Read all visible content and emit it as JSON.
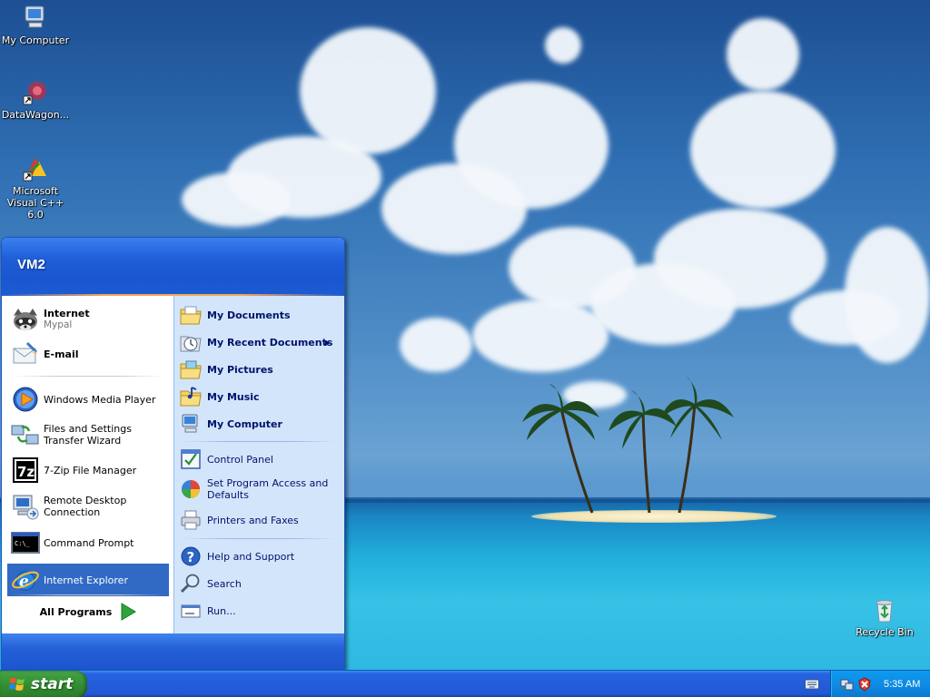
{
  "desktop": {
    "icons": [
      {
        "label": "My Computer"
      },
      {
        "label": "DataWagon..."
      },
      {
        "label": "Microsoft Visual C++ 6.0"
      },
      {
        "label": "Recycle Bin"
      }
    ]
  },
  "start_menu": {
    "user_name": "VM2",
    "pinned": [
      {
        "title": "Internet",
        "subtitle": "Mypal",
        "icon": "raccoon-browser-icon"
      },
      {
        "title": "E-mail",
        "icon": "email-icon"
      }
    ],
    "recent": [
      {
        "label": "Windows Media Player",
        "icon": "media-player-icon"
      },
      {
        "label": "Files and Settings Transfer Wizard",
        "icon": "transfer-wizard-icon"
      },
      {
        "label": "7-Zip File Manager",
        "icon": "7zip-icon"
      },
      {
        "label": "Remote Desktop Connection",
        "icon": "remote-desktop-icon"
      },
      {
        "label": "Command Prompt",
        "icon": "command-prompt-icon"
      },
      {
        "label": "Internet Explorer",
        "icon": "internet-explorer-icon",
        "selected": true
      }
    ],
    "all_programs_label": "All Programs",
    "places": [
      {
        "label": "My Documents"
      },
      {
        "label": "My Recent Documents",
        "has_submenu": true
      },
      {
        "label": "My Pictures"
      },
      {
        "label": "My Music"
      },
      {
        "label": "My Computer"
      }
    ],
    "settings": [
      {
        "label": "Control Panel"
      },
      {
        "label": "Set Program Access and Defaults"
      },
      {
        "label": "Printers and Faxes"
      }
    ],
    "help": [
      {
        "label": "Help and Support"
      },
      {
        "label": "Search"
      },
      {
        "label": "Run..."
      }
    ]
  },
  "taskbar": {
    "start_label": "start",
    "clock": "5:35 AM"
  },
  "colors": {
    "taskbar_blue": "#245ddb",
    "start_green": "#3c9d3c",
    "menu_header_blue": "#1f5fd8",
    "right_pane": "#d3e5fa",
    "selection": "#316ac5"
  }
}
